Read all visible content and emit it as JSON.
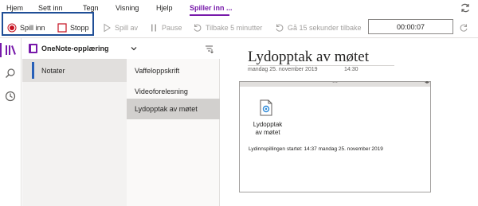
{
  "menu": {
    "items": [
      "Hjem",
      "Sett inn",
      "Tegn",
      "Visning",
      "Hjelp"
    ],
    "active_tab": "Spiller inn ..."
  },
  "ribbon": {
    "record_label": "Spill inn",
    "stop_label": "Stopp",
    "play_label": "Spill av",
    "pause_label": "Pause",
    "back5_label": "Tilbake 5 minutter",
    "back15_label": "Gå 15 sekunder tilbake",
    "timer": "00:00:07"
  },
  "notebook": {
    "title": "OneNote-opplæring"
  },
  "sections": [
    {
      "label": "Notater",
      "color": "#2860b8"
    }
  ],
  "pages": [
    {
      "label": "Vaffeloppskrift"
    },
    {
      "label": "Videoforelesning"
    },
    {
      "label": "Lydopptak av møtet"
    }
  ],
  "canvas": {
    "title": "Lydopptak av møtet",
    "date": "mandag 25. november 2019",
    "time": "14:30",
    "attachment_label": "Lydopptak av møtet",
    "recording_info": "Lydinnspillingen startet: 14:37 mandag 25. november 2019"
  },
  "colors": {
    "accent": "#7719aa",
    "record": "#c50f1f",
    "highlight": "#1f4e96"
  }
}
